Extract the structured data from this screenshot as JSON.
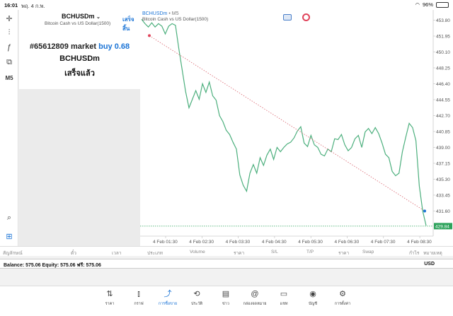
{
  "status_bar": {
    "time": "16:01",
    "date": "พฤ. 4 ก.พ.",
    "battery": "96%"
  },
  "toolbar": {
    "items": [
      {
        "name": "crosshair-icon",
        "glyph": "✛"
      },
      {
        "name": "indicators-icon",
        "glyph": "⫶"
      },
      {
        "name": "function-icon",
        "glyph": "ƒ"
      },
      {
        "name": "objects-icon",
        "glyph": "⧉"
      },
      {
        "name": "timeframe",
        "glyph": "M5"
      }
    ],
    "bottom_items": [
      {
        "name": "search-icon",
        "glyph": "⌕"
      },
      {
        "name": "add-chart-icon",
        "glyph": "⊞"
      }
    ]
  },
  "order": {
    "symbol": "BCHUSDm",
    "description": "Bitcoin Cash vs US Dollar(1500)",
    "done_label": "เสร็จสิ้น",
    "ticket": "#65612809 market",
    "action": "buy 0.68",
    "symbol_line": "BCHUSDm",
    "status": "เสร็จแล้ว"
  },
  "chart": {
    "symbol": "BCHUSDm",
    "timeframe": "M5",
    "description": "Bitcoin Cash vs US Dollar(1500)",
    "current_price": "429.84"
  },
  "chart_data": {
    "type": "line",
    "y_ticks": [
      "453.80",
      "451.95",
      "450.10",
      "448.25",
      "446.40",
      "444.55",
      "442.70",
      "440.85",
      "439.00",
      "437.15",
      "435.30",
      "433.45",
      "431.60"
    ],
    "x_ticks": [
      "4 Feb 01:30",
      "4 Feb 02:30",
      "4 Feb 03:30",
      "4 Feb 04:30",
      "4 Feb 05:30",
      "4 Feb 06:30",
      "4 Feb 07:30",
      "4 Feb 08:30"
    ],
    "ylim": [
      429.5,
      454.5
    ],
    "values": [
      453.9,
      453.4,
      453.0,
      453.5,
      453.0,
      453.4,
      453.1,
      452.2,
      453.1,
      453.4,
      453.2,
      450.5,
      448.0,
      445.5,
      443.6,
      444.6,
      445.6,
      444.6,
      446.4,
      445.4,
      446.6,
      445.0,
      444.5,
      442.7,
      442.0,
      441.0,
      440.5,
      439.6,
      438.8,
      435.8,
      434.6,
      433.9,
      436.0,
      437.0,
      436.0,
      437.8,
      436.9,
      438.1,
      438.8,
      437.6,
      439.0,
      438.5,
      439.0,
      439.4,
      439.6,
      440.1,
      440.9,
      441.4,
      439.5,
      439.1,
      440.4,
      439.3,
      439.0,
      438.2,
      438.0,
      438.8,
      438.5,
      440.0,
      439.9,
      440.5,
      439.3,
      438.6,
      439.0,
      440.0,
      440.4,
      439.0,
      440.8,
      441.2,
      440.6,
      441.3,
      440.6,
      439.5,
      438.2,
      437.8,
      436.2,
      435.7,
      436.0,
      438.5,
      440.2,
      441.8,
      441.3,
      439.8,
      434.5,
      431.6,
      429.9
    ],
    "trendline": {
      "start": 452.0,
      "end": 431.6
    },
    "current": 429.84
  },
  "columns": [
    "สัญลักษณ์",
    "ตั๋ว",
    "เวลา",
    "ประเภท",
    "Volume",
    "ราคา",
    "S/L",
    "T/P",
    "ราคา",
    "Swap",
    "กำไร",
    "หมายเหตุ"
  ],
  "balance": {
    "text": "Balance: 575.06  Equity: 575.06  ฟรี: 575.06",
    "currency": "USD"
  },
  "nav": [
    {
      "label": "ราคา",
      "glyph": "⇅",
      "name": "nav-quotes"
    },
    {
      "label": "กราฟ",
      "glyph": "⫾",
      "name": "nav-charts"
    },
    {
      "label": "การซื้อขาย",
      "glyph": "⤴",
      "name": "nav-trade"
    },
    {
      "label": "ประวัติ",
      "glyph": "⟲",
      "name": "nav-history"
    },
    {
      "label": "ข่าว",
      "glyph": "▤",
      "name": "nav-news"
    },
    {
      "label": "กล่องจดหมาย",
      "glyph": "@",
      "name": "nav-mailbox"
    },
    {
      "label": "แชท",
      "glyph": "▭",
      "name": "nav-chat"
    },
    {
      "label": "บัญชี",
      "glyph": "◉",
      "name": "nav-accounts"
    },
    {
      "label": "การตั้งค่า",
      "glyph": "⚙",
      "name": "nav-settings"
    }
  ],
  "colors": {
    "accent": "#1b74d6",
    "line": "#4caf7d",
    "sell_marker": "#e0435a",
    "trend": "#d9646e",
    "price_tag": "#2ea35c"
  }
}
